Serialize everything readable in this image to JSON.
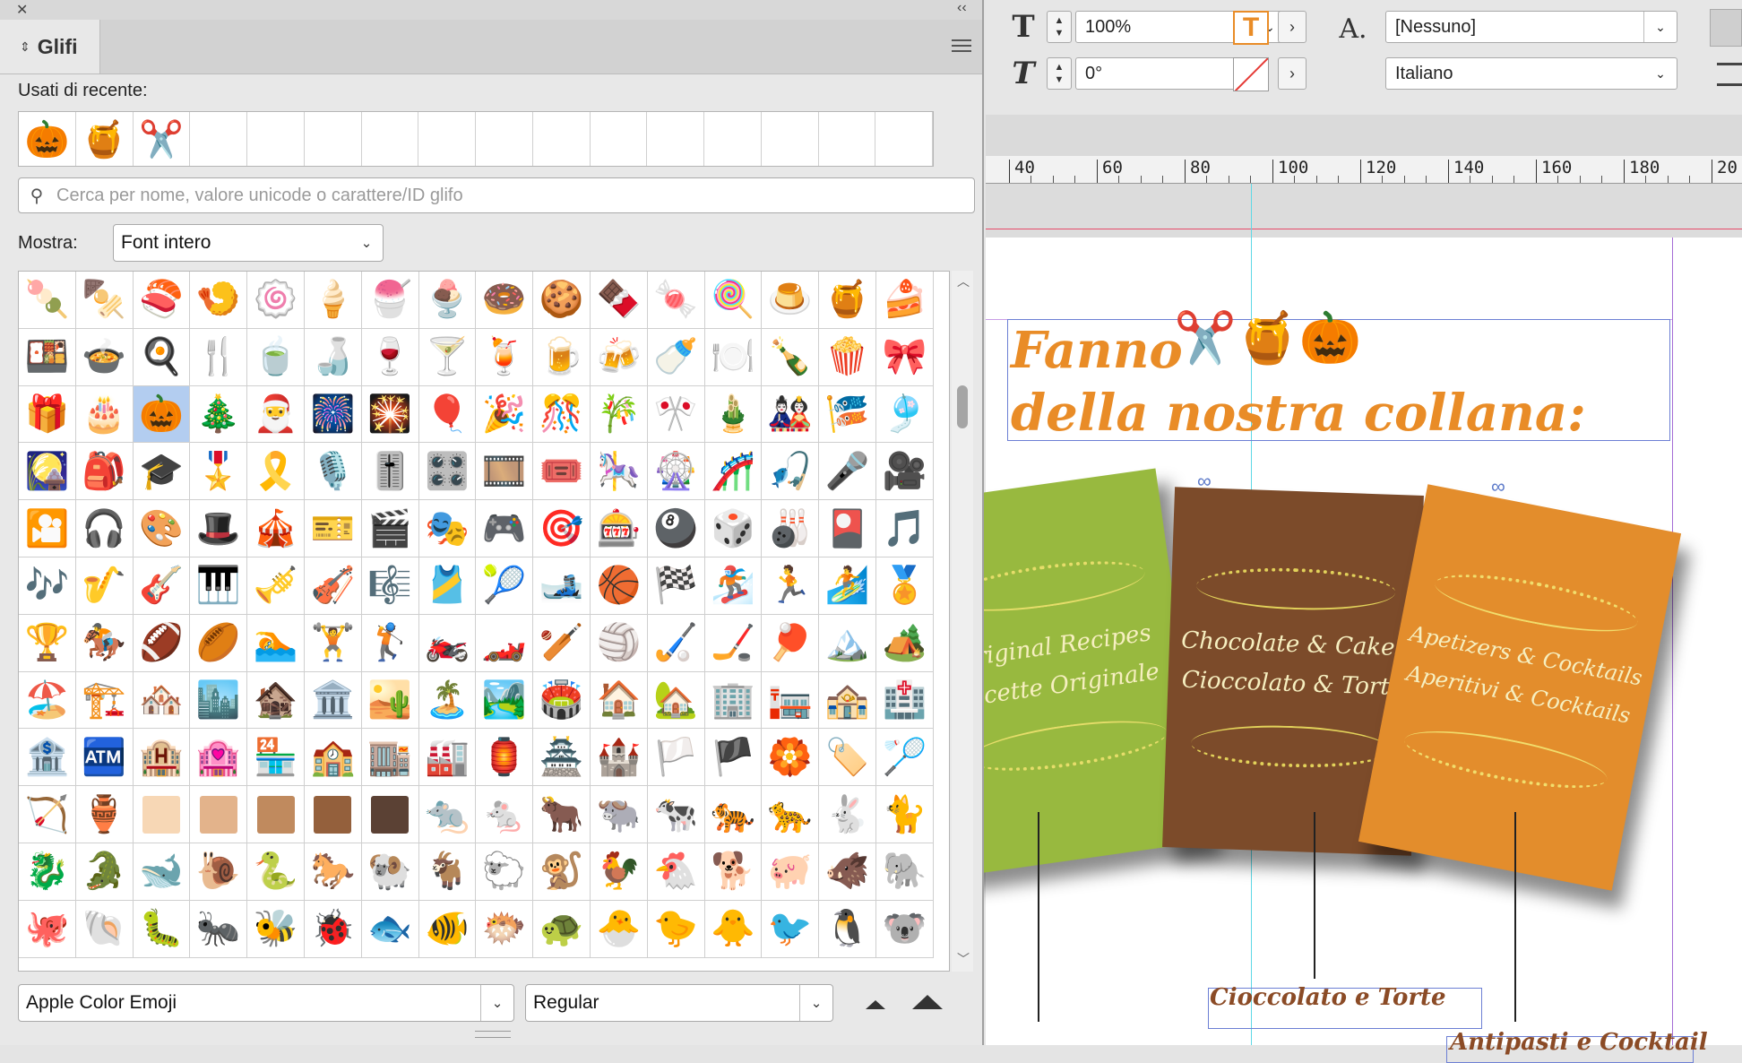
{
  "control_bar": {
    "scale_value": "100%",
    "angle_value": "0°",
    "char_style_value": "[Nessuno]",
    "language_value": "Italiano"
  },
  "ruler": {
    "labels": [
      "40",
      "60",
      "80",
      "100",
      "120",
      "140",
      "160",
      "180",
      "20"
    ]
  },
  "document": {
    "title_line1": "Fanno",
    "title_line1_emojis": "✂️🍯🎃",
    "title_line2": "della nostra collana:",
    "cards": [
      {
        "line1": "Original Recipes",
        "line2": "Ricette Originale",
        "color": "#98b93f"
      },
      {
        "line1": "Chocolate & Cakes",
        "line2": "Cioccolato & Torte",
        "color": "#7c4b2a"
      },
      {
        "line1": "Apetizers & Cocktails",
        "line2": "Aperitivi & Cocktails",
        "color": "#e38d2c"
      }
    ],
    "caption_1": "Cioccolato e Torte",
    "caption_2": "Antipasti e Cocktail"
  },
  "panel": {
    "close_glyph": "✕",
    "collapse_glyph": "‹‹",
    "tab_title": "Glifi",
    "recent_label": "Usati di recente:",
    "recent_glyphs": [
      "🎃",
      "🍯",
      "✂️",
      "",
      "",
      "",
      "",
      "",
      "",
      "",
      "",
      "",
      "",
      "",
      "",
      ""
    ],
    "search_placeholder": "Cerca per nome, valore unicode o carattere/ID glifo",
    "show_label": "Mostra:",
    "show_value": "Font intero",
    "font_family": "Apple Color Emoji",
    "font_style": "Regular",
    "grid_rows": [
      [
        "🍡",
        "🍢",
        "🍣",
        "🍤",
        "🍥",
        "🍦",
        "🍧",
        "🍨",
        "🍩",
        "🍪",
        "🍫",
        "🍬",
        "🍭",
        "🍮",
        "🍯",
        "🍰"
      ],
      [
        "🍱",
        "🍲",
        "🍳",
        "🍴",
        "🍵",
        "🍶",
        "🍷",
        "🍸",
        "🍹",
        "🍺",
        "🍻",
        "🍼",
        "🍽️",
        "🍾",
        "🍿",
        "🎀"
      ],
      [
        "🎁",
        "🎂",
        "🎃",
        "🎄",
        "🎅",
        "🎆",
        "🎇",
        "🎈",
        "🎉",
        "🎊",
        "🎋",
        "🎌",
        "🎍",
        "🎎",
        "🎏",
        "🎐"
      ],
      [
        "🎑",
        "🎒",
        "🎓",
        "🎖️",
        "🎗️",
        "🎙️",
        "🎚️",
        "🎛️",
        "🎞️",
        "🎟️",
        "🎠",
        "🎡",
        "🎢",
        "🎣",
        "🎤",
        "🎥"
      ],
      [
        "🎦",
        "🎧",
        "🎨",
        "🎩",
        "🎪",
        "🎫",
        "🎬",
        "🎭",
        "🎮",
        "🎯",
        "🎰",
        "🎱",
        "🎲",
        "🎳",
        "🎴",
        "🎵"
      ],
      [
        "🎶",
        "🎷",
        "🎸",
        "🎹",
        "🎺",
        "🎻",
        "🎼",
        "🎽",
        "🎾",
        "🎿",
        "🏀",
        "🏁",
        "🏂",
        "🏃",
        "🏄",
        "🏅"
      ],
      [
        "🏆",
        "🏇",
        "🏈",
        "🏉",
        "🏊",
        "🏋️",
        "🏌️",
        "🏍️",
        "🏎️",
        "🏏",
        "🏐",
        "🏑",
        "🏒",
        "🏓",
        "🏔️",
        "🏕️"
      ],
      [
        "🏖️",
        "🏗️",
        "🏘️",
        "🏙️",
        "🏚️",
        "🏛️",
        "🏜️",
        "🏝️",
        "🏞️",
        "🏟️",
        "🏠",
        "🏡",
        "🏢",
        "🏣",
        "🏤",
        "🏥"
      ],
      [
        "🏦",
        "🏧",
        "🏨",
        "🏩",
        "🏪",
        "🏫",
        "🏬",
        "🏭",
        "🏮",
        "🏯",
        "🏰",
        "🏳️",
        "🏴",
        "🏵️",
        "🏷️",
        "🏸"
      ],
      [
        "🏹",
        "🏺",
        "",
        "",
        "",
        "",
        "",
        "🐀",
        "🐁",
        "🐂",
        "🐃",
        "🐄",
        "🐅",
        "🐆",
        "🐇",
        "🐈"
      ],
      [
        "🐉",
        "🐊",
        "🐋",
        "🐌",
        "🐍",
        "🐎",
        "🐏",
        "🐐",
        "🐑",
        "🐒",
        "🐓",
        "🐔",
        "🐕",
        "🐖",
        "🐗",
        "🐘"
      ],
      [
        "🐙",
        "🐚",
        "🐛",
        "🐜",
        "🐝",
        "🐞",
        "🐟",
        "🐠",
        "🐡",
        "🐢",
        "🐣",
        "🐤",
        "🐥",
        "🐦",
        "🐧",
        "🐨"
      ]
    ],
    "skin_tone_colors": [
      "#f7d7b5",
      "#e3b38b",
      "#c08a5e",
      "#94603c",
      "#5b4134"
    ]
  }
}
